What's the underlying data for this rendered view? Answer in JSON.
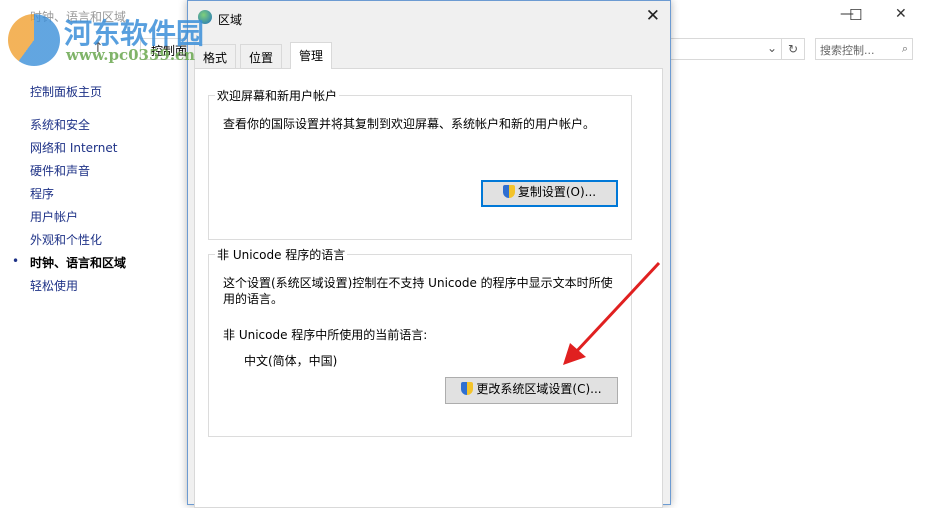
{
  "background_window": {
    "title": "时钟、语言和区域",
    "breadcrumb": "控制面",
    "search_placeholder": "搜索控制...",
    "sidebar": [
      {
        "label": "控制面板主页"
      },
      {
        "label": "系统和安全"
      },
      {
        "label": "网络和 Internet"
      },
      {
        "label": "硬件和声音"
      },
      {
        "label": "程序"
      },
      {
        "label": "用户帐户"
      },
      {
        "label": "外观和个性化"
      },
      {
        "label": "时钟、语言和区域",
        "active": true
      },
      {
        "label": "轻松使用"
      }
    ]
  },
  "dialog": {
    "title": "区域",
    "tabs": [
      {
        "label": "格式"
      },
      {
        "label": "位置"
      },
      {
        "label": "管理",
        "selected": true
      }
    ],
    "welcome_group": {
      "label": "欢迎屏幕和新用户帐户",
      "text": "查看你的国际设置并将其复制到欢迎屏幕、系统帐户和新的用户帐户。",
      "button": "复制设置(O)..."
    },
    "unicode_group": {
      "label": "非 Unicode 程序的语言",
      "text": "这个设置(系统区域设置)控制在不支持 Unicode 的程序中显示文本时所使用的语言。",
      "current_label": "非 Unicode 程序中所使用的当前语言:",
      "current_value": "中文(简体，中国)",
      "button": "更改系统区域设置(C)..."
    }
  },
  "watermark": {
    "name": "河东软件园",
    "url": "www.pc0359.cn"
  },
  "colors": {
    "arrow": "#e02020",
    "accent": "#0078d7"
  }
}
